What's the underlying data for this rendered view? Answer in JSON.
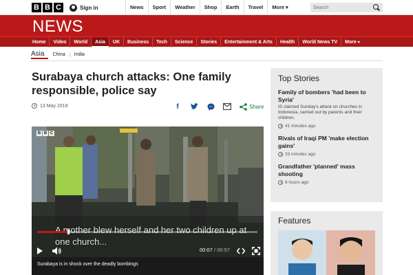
{
  "topbar": {
    "logo_letters": [
      "B",
      "B",
      "C"
    ],
    "signin_label": "Sign in",
    "nav": [
      "News",
      "Sport",
      "Weather",
      "Shop",
      "Earth",
      "Travel",
      "More"
    ],
    "search_placeholder": "Search"
  },
  "header": {
    "title": "NEWS",
    "brand_color": "#bb1919"
  },
  "section_nav": {
    "items": [
      "Home",
      "Video",
      "World",
      "Asia",
      "UK",
      "Business",
      "Tech",
      "Science",
      "Stories",
      "Entertainment & Arts",
      "Health",
      "World News TV",
      "More"
    ],
    "active": "Asia"
  },
  "subnav": {
    "current": "Asia",
    "items": [
      "China",
      "India"
    ]
  },
  "article": {
    "headline": "Surabaya church attacks: One family responsible, police say",
    "date": "13 May 2018",
    "share_label": "Share",
    "share_icons": [
      "facebook-icon",
      "twitter-icon",
      "messenger-icon",
      "email-icon",
      "share-icon"
    ]
  },
  "video": {
    "logo_letters": [
      "B",
      "B",
      "C"
    ],
    "subtitle": "A mother blew herself and her two children up at one church...",
    "time_current": "00:07",
    "time_separator": "/",
    "time_total": "00:57",
    "progress_fraction": 0.14,
    "caption": "Surabaya is in shock over the deadly bombings"
  },
  "top_stories": {
    "heading": "Top Stories",
    "items": [
      {
        "title": "Family of bombers 'had been to Syria'",
        "summary": "IS claimed Sunday's attack on churches in Indonesia, carried out by parents and their children.",
        "time": "41 minutes ago"
      },
      {
        "title": "Rivals of Iraqi PM 'make election gains'",
        "summary": "",
        "time": "33 minutes ago"
      },
      {
        "title": "Grandfather 'planned' mass shooting",
        "summary": "",
        "time": "8 hours ago"
      }
    ]
  },
  "features": {
    "heading": "Features"
  }
}
